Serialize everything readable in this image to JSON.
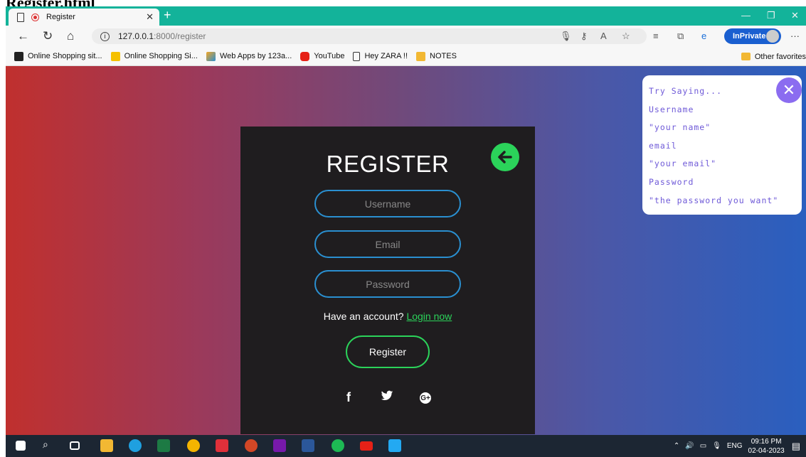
{
  "page_heading": "Register.html",
  "browser": {
    "tab_title": "Register",
    "url_host": "127.0.0.1",
    "url_path": ":8000/register",
    "inprivate_label": "InPrivate",
    "favorites": [
      "Online Shopping sit...",
      "Online Shopping Si...",
      "Web Apps by 123a...",
      "YouTube",
      "Hey ZARA !!",
      "NOTES"
    ],
    "other_favorites": "Other favorites"
  },
  "form": {
    "title": "REGISTER",
    "username_placeholder": "Username",
    "email_placeholder": "Email",
    "password_placeholder": "Password",
    "have_account_text": "Have an account?",
    "login_link": "Login now",
    "register_button": "Register",
    "social": [
      "f",
      "t",
      "G+"
    ]
  },
  "hints": {
    "lines": [
      "Try Saying...",
      "Username",
      "\"your name\"",
      "email",
      "\"your email\"",
      "Password",
      "\"the password you want\""
    ]
  },
  "taskbar": {
    "lang": "ENG",
    "time": "09:16 PM",
    "date": "02-04-2023"
  },
  "colors": {
    "accent_green": "#2bd35a",
    "field_border": "#2a8fd0",
    "hint_text": "#6f5ad8"
  }
}
